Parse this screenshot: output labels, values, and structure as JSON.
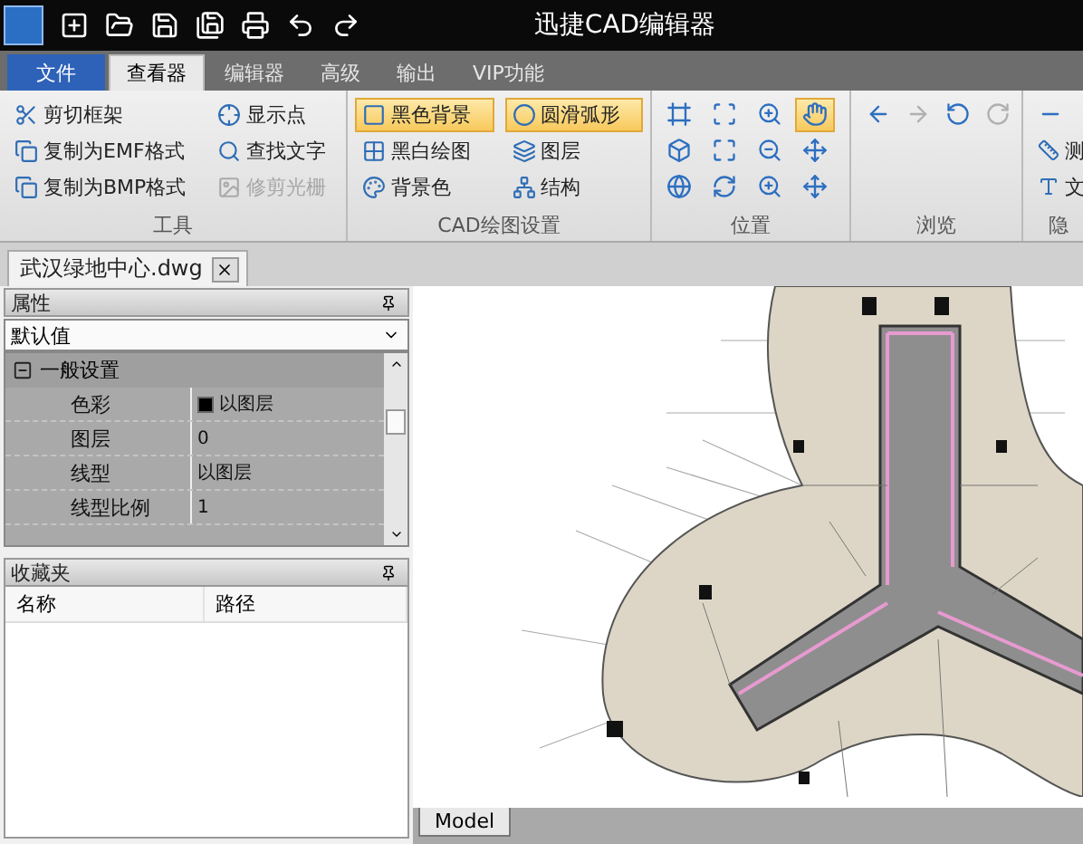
{
  "window": {
    "title": "迅捷CAD编辑器"
  },
  "ribbon_tabs": [
    {
      "label": "文件",
      "kind": "file",
      "selected": false
    },
    {
      "label": "查看器",
      "kind": "tab",
      "selected": true
    },
    {
      "label": "编辑器",
      "kind": "tab",
      "selected": false
    },
    {
      "label": "高级",
      "kind": "tab",
      "selected": false
    },
    {
      "label": "输出",
      "kind": "tab",
      "selected": false
    },
    {
      "label": "VIP功能",
      "kind": "tab",
      "selected": false
    }
  ],
  "tools_group": {
    "title": "工具",
    "items": [
      {
        "label": "剪切框架",
        "disabled": false
      },
      {
        "label": "显示点",
        "disabled": false
      },
      {
        "label": "复制为EMF格式",
        "disabled": false
      },
      {
        "label": "查找文字",
        "disabled": false
      },
      {
        "label": "复制为BMP格式",
        "disabled": false
      },
      {
        "label": "修剪光栅",
        "disabled": true
      }
    ]
  },
  "drawing_group": {
    "title": "CAD绘图设置",
    "items": [
      {
        "label": "黑色背景",
        "selected": true
      },
      {
        "label": "圆滑弧形",
        "selected": true
      },
      {
        "label": "黑白绘图",
        "selected": false
      },
      {
        "label": "图层",
        "selected": false
      },
      {
        "label": "背景色",
        "selected": false
      },
      {
        "label": "结构",
        "selected": false
      }
    ]
  },
  "position_group": {
    "title": "位置",
    "buttons": [
      {
        "selected": false
      },
      {
        "selected": false
      },
      {
        "selected": false
      },
      {
        "selected": true
      },
      {
        "selected": false
      },
      {
        "selected": false
      },
      {
        "selected": false
      },
      {
        "selected": false
      },
      {
        "selected": false
      },
      {
        "selected": false
      },
      {
        "selected": false
      },
      {
        "selected": false
      }
    ]
  },
  "browse_group": {
    "title": "浏览",
    "buttons": [
      {
        "disabled": false
      },
      {
        "disabled": true
      },
      {
        "disabled": false
      },
      {
        "disabled": true
      }
    ]
  },
  "hidden_group": {
    "title": "隐",
    "items": [
      {
        "label": "测"
      },
      {
        "label": "文"
      }
    ]
  },
  "document_tab": {
    "label": "武汉绿地中心.dwg"
  },
  "properties": {
    "title": "属性",
    "preset": "默认值",
    "category": {
      "label": "一般设置",
      "expanded": true
    },
    "rows": [
      {
        "name": "色彩",
        "value": "以图层",
        "color": "#000000"
      },
      {
        "name": "图层",
        "value": "0"
      },
      {
        "name": "线型",
        "value": "以图层"
      },
      {
        "name": "线型比例",
        "value": "1"
      }
    ]
  },
  "favorites": {
    "title": "收藏夹",
    "columns": [
      "名称",
      "路径"
    ]
  },
  "layout_tabs": [
    {
      "label": "Model",
      "selected": true
    }
  ]
}
